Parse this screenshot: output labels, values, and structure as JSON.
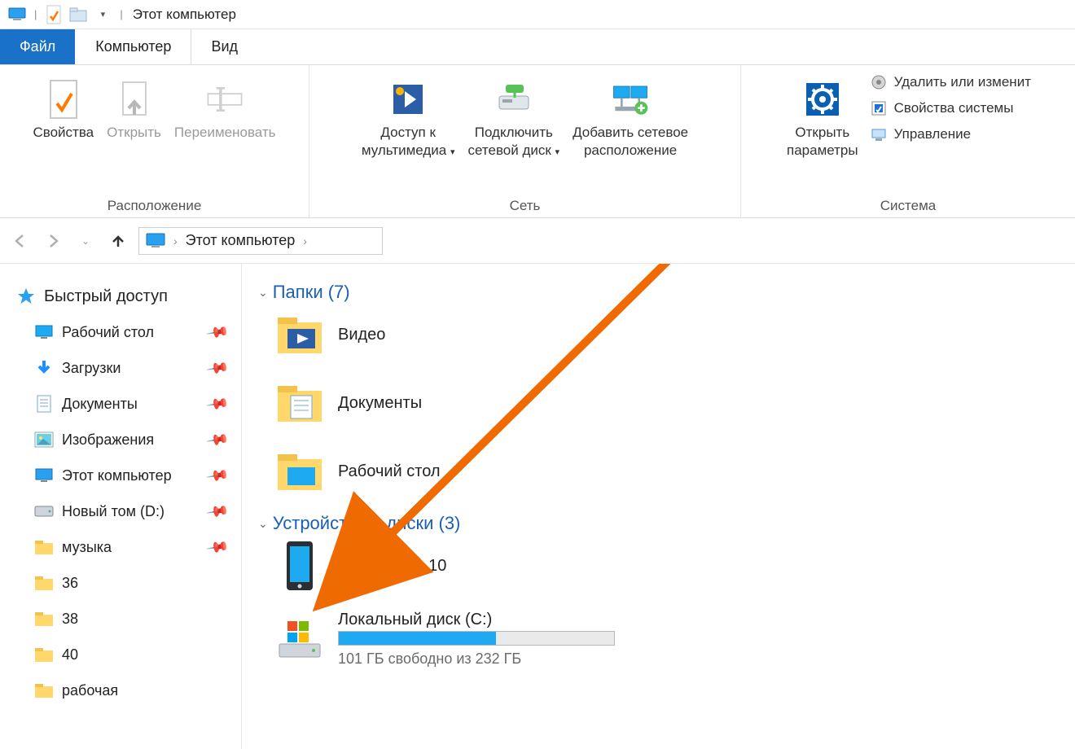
{
  "titlebar": {
    "title": "Этот компьютер",
    "dropdown_glyph": "▾"
  },
  "tabs": {
    "file": "Файл",
    "computer": "Компьютер",
    "view": "Вид"
  },
  "ribbon": {
    "group_location": {
      "label": "Расположение",
      "properties": "Свойства",
      "open": "Открыть",
      "rename": "Переименовать"
    },
    "group_network": {
      "label": "Сеть",
      "media_access_l1": "Доступ к",
      "media_access_l2": "мультимедиа",
      "map_drive_l1": "Подключить",
      "map_drive_l2": "сетевой диск",
      "add_netloc_l1": "Добавить сетевое",
      "add_netloc_l2": "расположение"
    },
    "group_system": {
      "label": "Система",
      "open_settings_l1": "Открыть",
      "open_settings_l2": "параметры",
      "uninstall": "Удалить или изменит",
      "sys_props": "Свойства системы",
      "manage": "Управление"
    }
  },
  "breadcrumb": {
    "root": "Этот компьютер"
  },
  "sidebar": {
    "quick_access": "Быстрый доступ",
    "items": [
      {
        "label": "Рабочий стол",
        "icon": "desktop",
        "pinned": true
      },
      {
        "label": "Загрузки",
        "icon": "downloads",
        "pinned": true
      },
      {
        "label": "Документы",
        "icon": "documents",
        "pinned": true
      },
      {
        "label": "Изображения",
        "icon": "pictures",
        "pinned": true
      },
      {
        "label": "Этот компьютер",
        "icon": "thispc",
        "pinned": true
      },
      {
        "label": "Новый том (D:)",
        "icon": "hdd",
        "pinned": true
      },
      {
        "label": "музыка",
        "icon": "folder",
        "pinned": true
      },
      {
        "label": "36",
        "icon": "folder",
        "pinned": false
      },
      {
        "label": "38",
        "icon": "folder",
        "pinned": false
      },
      {
        "label": "40",
        "icon": "folder",
        "pinned": false
      },
      {
        "label": "рабочая",
        "icon": "folder",
        "pinned": false
      }
    ]
  },
  "content": {
    "folders_header": "Папки (7)",
    "folders": [
      {
        "label": "Видео",
        "icon": "video"
      },
      {
        "label": "Документы",
        "icon": "documents"
      },
      {
        "label": "Рабочий стол",
        "icon": "desktop"
      }
    ],
    "devices_header": "Устройства и диски (3)",
    "devices": {
      "phone": {
        "label": "Redmi Note 10"
      },
      "cdrive": {
        "label": "Локальный диск (C:)",
        "free_text": "101 ГБ свободно из 232 ГБ",
        "used_pct": 57
      }
    }
  }
}
